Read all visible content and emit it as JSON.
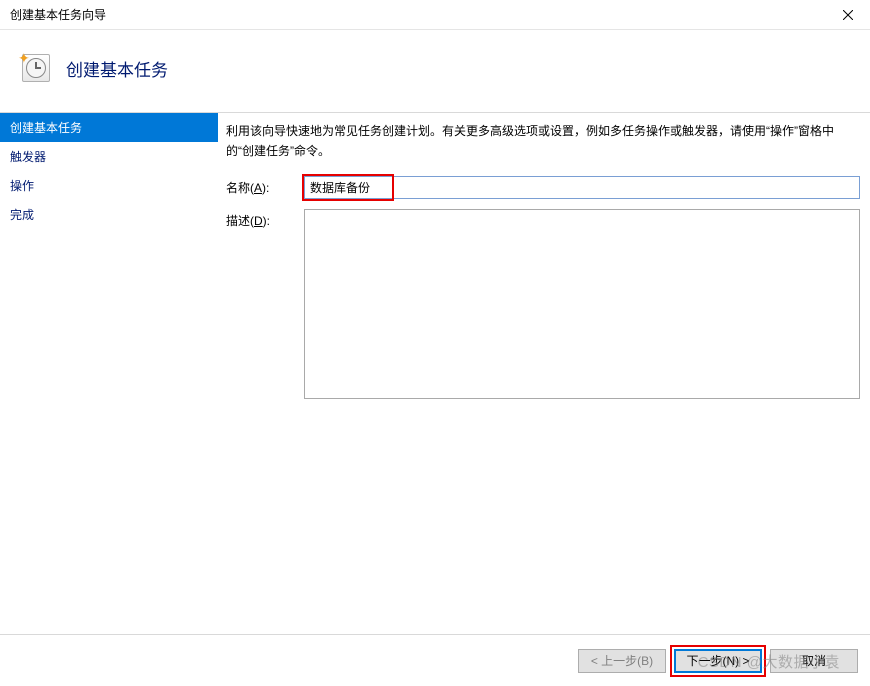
{
  "window": {
    "title": "创建基本任务向导"
  },
  "header": {
    "title": "创建基本任务"
  },
  "sidebar": {
    "items": [
      {
        "label": "创建基本任务",
        "active": true
      },
      {
        "label": "触发器",
        "active": false
      },
      {
        "label": "操作",
        "active": false
      },
      {
        "label": "完成",
        "active": false
      }
    ]
  },
  "content": {
    "intro": "利用该向导快速地为常见任务创建计划。有关更多高级选项或设置，例如多任务操作或触发器，请使用“操作”窗格中的“创建任务”命令。",
    "name_label_prefix": "名称(",
    "name_label_key": "A",
    "name_label_suffix": "):",
    "name_value": "数据库备份",
    "desc_label_prefix": "描述(",
    "desc_label_key": "D",
    "desc_label_suffix": "):",
    "desc_value": ""
  },
  "footer": {
    "back": "< 上一步(B)",
    "next": "下一步(N) >",
    "cancel": "取消"
  },
  "watermark": "CSDN @大数据小袁"
}
